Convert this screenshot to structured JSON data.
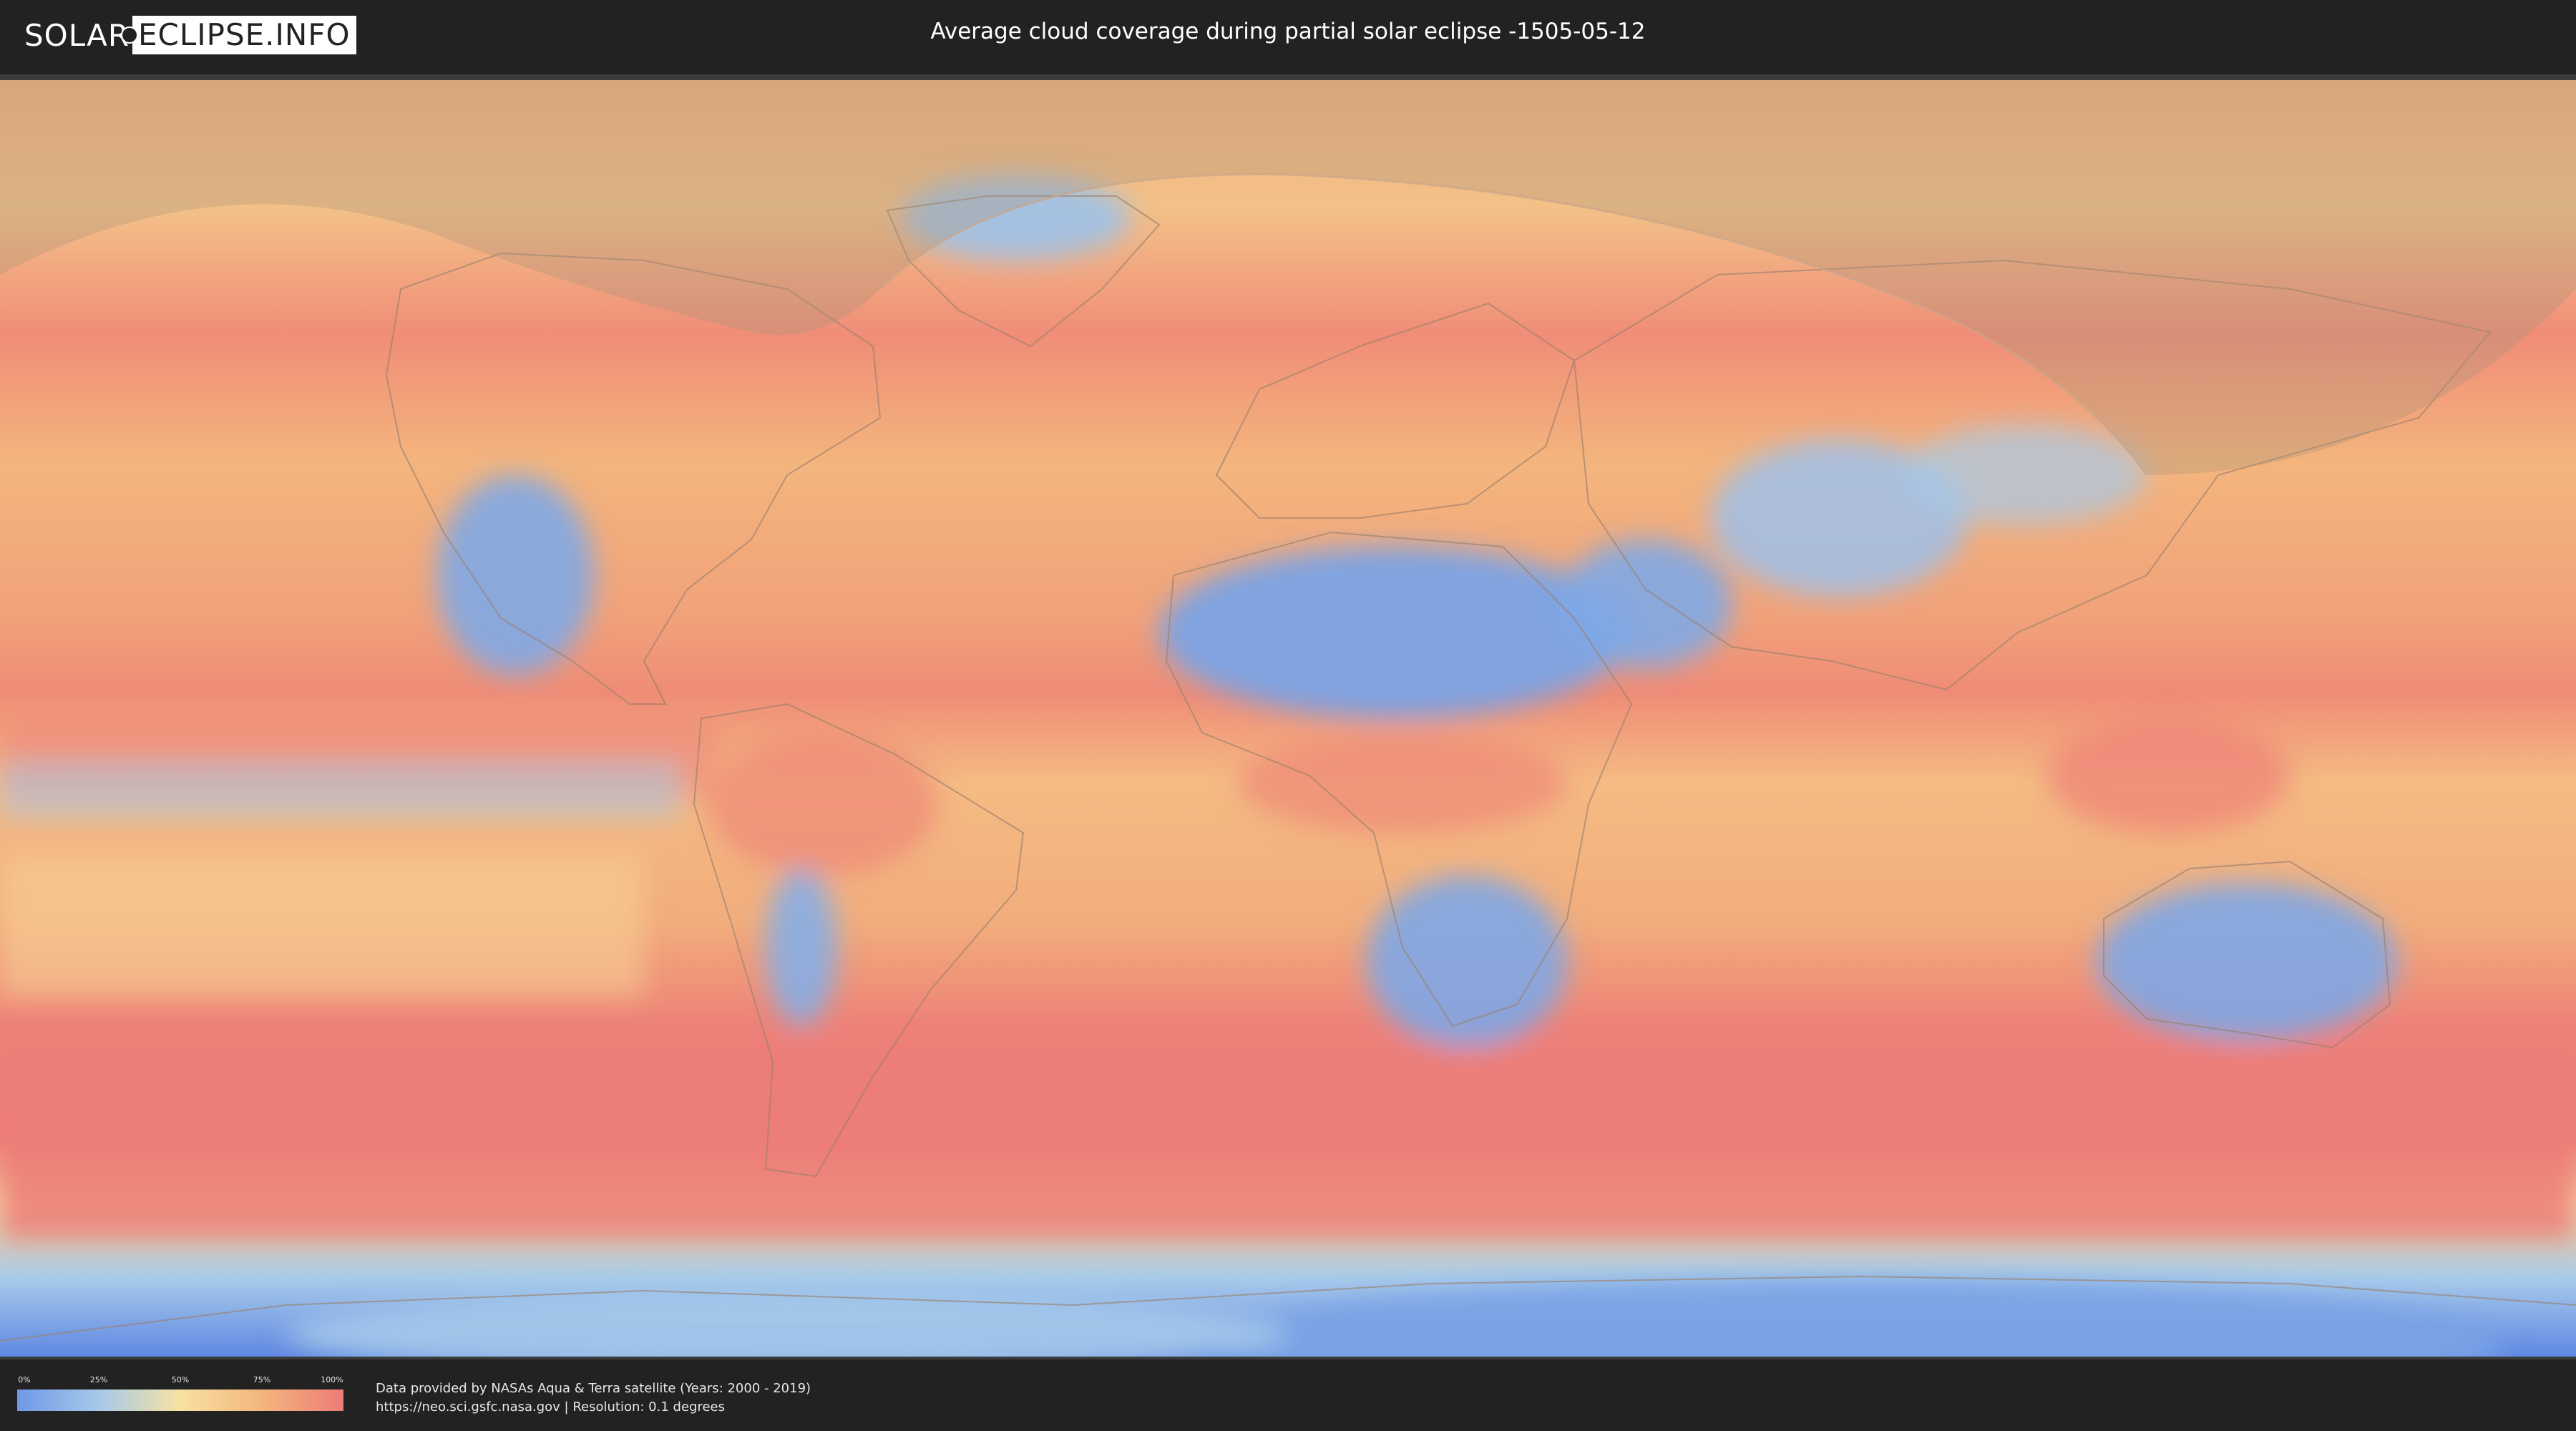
{
  "header": {
    "logo_left": "SOLAR",
    "logo_right": "ECLIPSE.INFO",
    "title": "Average cloud coverage during partial solar eclipse -1505-05-12"
  },
  "legend": {
    "ticks": [
      "0%",
      "25%",
      "50%",
      "75%",
      "100%"
    ],
    "colors": [
      "#6f98e6",
      "#a6c9ea",
      "#f7e2a2",
      "#f4b57d",
      "#ee7b78"
    ]
  },
  "footer": {
    "credit_line_1": "Data provided by NASAs Aqua & Terra satellite (Years: 2000 - 2019)",
    "credit_line_2": "https://neo.sci.gsfc.nasa.gov | Resolution: 0.1 degrees"
  },
  "map": {
    "background_color": "#f2a36f",
    "ocean_cloud_band_color": "#ec7e77",
    "clear_area_color": "#7aa6e6",
    "eclipse_overlay_color": "#b09070"
  }
}
